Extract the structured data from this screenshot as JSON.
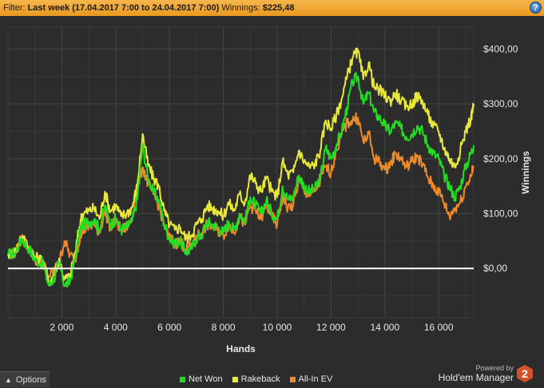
{
  "filter": {
    "prefix": "Filter:",
    "range_label": "Last week (17.04.2017 7:00 to 24.04.2017 7:00)",
    "winnings_label": "Winnings:",
    "winnings_value": "$225,48"
  },
  "help_label": "?",
  "options": {
    "label": "Options"
  },
  "powered": {
    "by": "Powered by",
    "product": "Hold'em Manager",
    "logo_digit": "2"
  },
  "colors": {
    "net_won": "#22dd22",
    "rakeback": "#e8e83a",
    "allin_ev": "#ee8a2a",
    "zero_line": "#ffffff",
    "plot_bg": "#2c2c2c",
    "grid": "#444444"
  },
  "chart_data": {
    "type": "line",
    "title": "",
    "xlabel": "Hands",
    "ylabel": "Winnings",
    "xlim": [
      0,
      17300
    ],
    "ylim": [
      -90,
      440
    ],
    "x_ticks": [
      2000,
      4000,
      6000,
      8000,
      10000,
      12000,
      14000,
      16000
    ],
    "x_tick_labels": [
      "2 000",
      "4 000",
      "6 000",
      "8 000",
      "10 000",
      "12 000",
      "14 000",
      "16 000"
    ],
    "y_ticks": [
      0,
      100,
      200,
      300,
      400
    ],
    "y_tick_labels": [
      "$0,00",
      "$100,00",
      "$200,00",
      "$300,00",
      "$400,00"
    ],
    "grid": true,
    "legend_position": "bottom",
    "series": [
      {
        "name": "Net Won",
        "x": [
          0,
          300,
          500,
          800,
          1000,
          1300,
          1500,
          1700,
          1900,
          2100,
          2300,
          2500,
          2700,
          2800,
          3000,
          3200,
          3400,
          3600,
          3800,
          4000,
          4200,
          4400,
          4600,
          4800,
          5000,
          5200,
          5400,
          5600,
          5800,
          6000,
          6200,
          6400,
          6600,
          6800,
          7000,
          7200,
          7400,
          7600,
          7800,
          8000,
          8200,
          8400,
          8600,
          8800,
          9000,
          9200,
          9400,
          9600,
          9800,
          10000,
          10200,
          10400,
          10600,
          10800,
          11000,
          11200,
          11400,
          11600,
          11800,
          12000,
          12200,
          12400,
          12600,
          12800,
          13000,
          13200,
          13400,
          13600,
          13800,
          14000,
          14200,
          14400,
          14600,
          14800,
          15000,
          15200,
          15400,
          15600,
          15800,
          16000,
          16200,
          16400,
          16600,
          16800,
          17000,
          17200,
          17300
        ],
        "values": [
          25,
          30,
          55,
          35,
          15,
          10,
          -30,
          -20,
          10,
          -30,
          -25,
          20,
          75,
          80,
          85,
          90,
          70,
          115,
          80,
          90,
          70,
          75,
          85,
          125,
          225,
          165,
          140,
          125,
          80,
          55,
          45,
          50,
          30,
          35,
          55,
          60,
          85,
          80,
          75,
          65,
          85,
          70,
          100,
          85,
          130,
          115,
          100,
          125,
          100,
          90,
          150,
          125,
          130,
          170,
          150,
          140,
          145,
          165,
          220,
          200,
          225,
          250,
          295,
          340,
          350,
          300,
          320,
          285,
          275,
          260,
          250,
          265,
          255,
          240,
          245,
          260,
          250,
          225,
          210,
          200,
          170,
          150,
          130,
          150,
          185,
          210,
          225
        ]
      },
      {
        "name": "Rakeback",
        "x": [
          0,
          300,
          500,
          800,
          1000,
          1300,
          1500,
          1700,
          1900,
          2100,
          2300,
          2500,
          2700,
          2800,
          3000,
          3200,
          3400,
          3600,
          3800,
          4000,
          4200,
          4400,
          4600,
          4800,
          5000,
          5200,
          5400,
          5600,
          5800,
          6000,
          6200,
          6400,
          6600,
          6800,
          7000,
          7200,
          7400,
          7600,
          7800,
          8000,
          8200,
          8400,
          8600,
          8800,
          9000,
          9200,
          9400,
          9600,
          9800,
          10000,
          10200,
          10400,
          10600,
          10800,
          11000,
          11200,
          11400,
          11600,
          11800,
          12000,
          12200,
          12400,
          12600,
          12800,
          13000,
          13200,
          13400,
          13600,
          13800,
          14000,
          14200,
          14400,
          14600,
          14800,
          15000,
          15200,
          15400,
          15600,
          15800,
          16000,
          16200,
          16400,
          16600,
          16800,
          17000,
          17200,
          17300
        ],
        "values": [
          26,
          32,
          58,
          40,
          20,
          15,
          -25,
          -12,
          18,
          -20,
          -15,
          30,
          90,
          100,
          105,
          110,
          90,
          140,
          105,
          115,
          95,
          100,
          110,
          150,
          245,
          190,
          165,
          150,
          105,
          80,
          70,
          75,
          55,
          60,
          80,
          90,
          115,
          110,
          105,
          95,
          120,
          105,
          135,
          120,
          170,
          155,
          140,
          165,
          140,
          130,
          195,
          170,
          175,
          215,
          195,
          185,
          190,
          215,
          270,
          255,
          280,
          310,
          350,
          385,
          395,
          345,
          375,
          330,
          325,
          315,
          305,
          320,
          305,
          295,
          300,
          315,
          305,
          280,
          260,
          250,
          220,
          200,
          185,
          215,
          250,
          275,
          300
        ]
      },
      {
        "name": "All-In EV",
        "x": [
          0,
          300,
          500,
          800,
          1000,
          1300,
          1500,
          1700,
          1900,
          2100,
          2300,
          2500,
          2700,
          2800,
          3000,
          3200,
          3400,
          3600,
          3800,
          4000,
          4200,
          4400,
          4600,
          4800,
          5000,
          5200,
          5400,
          5600,
          5800,
          6000,
          6200,
          6400,
          6600,
          6800,
          7000,
          7200,
          7400,
          7600,
          7800,
          8000,
          8200,
          8400,
          8600,
          8800,
          9000,
          9200,
          9400,
          9600,
          9800,
          10000,
          10200,
          10400,
          10600,
          10800,
          11000,
          11200,
          11400,
          11600,
          11800,
          12000,
          12200,
          12400,
          12600,
          12800,
          13000,
          13200,
          13400,
          13600,
          13800,
          14000,
          14200,
          14400,
          14600,
          14800,
          15000,
          15200,
          15400,
          15600,
          15800,
          16000,
          16200,
          16400,
          16600,
          16800,
          17000,
          17200,
          17300
        ],
        "values": [
          25,
          30,
          55,
          38,
          15,
          12,
          -15,
          -5,
          10,
          50,
          25,
          15,
          65,
          70,
          75,
          80,
          65,
          105,
          75,
          85,
          70,
          75,
          90,
          150,
          185,
          155,
          135,
          115,
          80,
          55,
          45,
          50,
          35,
          40,
          60,
          65,
          80,
          75,
          70,
          60,
          80,
          65,
          95,
          80,
          115,
          105,
          90,
          115,
          95,
          80,
          130,
          110,
          115,
          160,
          140,
          135,
          140,
          160,
          185,
          175,
          215,
          245,
          265,
          270,
          275,
          230,
          245,
          200,
          195,
          180,
          190,
          210,
          200,
          185,
          195,
          205,
          190,
          165,
          150,
          140,
          120,
          95,
          110,
          120,
          150,
          170,
          185
        ]
      }
    ]
  }
}
